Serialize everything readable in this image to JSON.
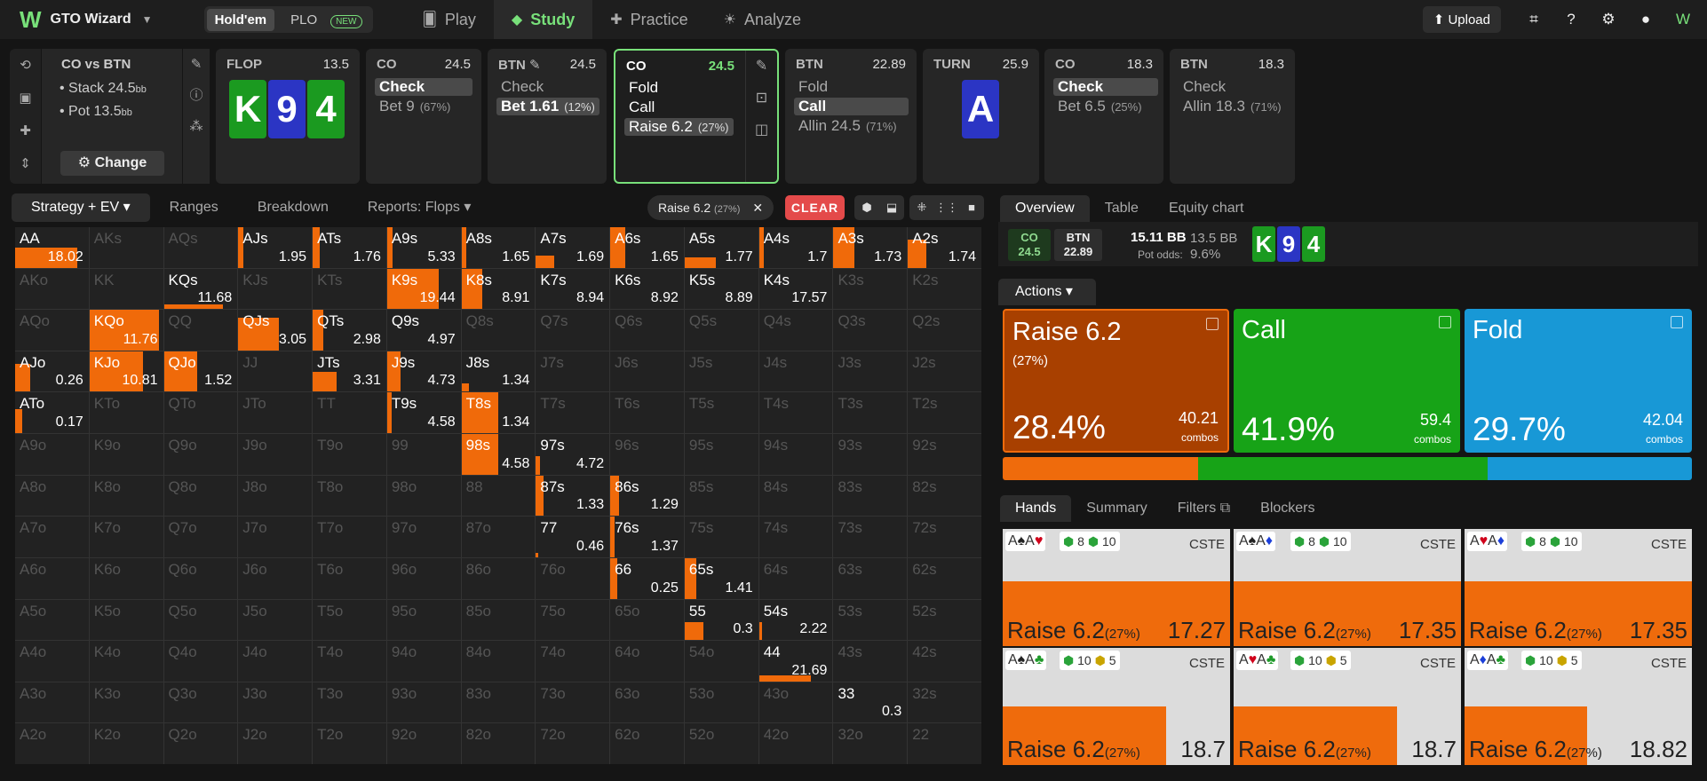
{
  "app": {
    "name": "GTO Wizard",
    "game_modes": [
      "Hold'em",
      "PLO"
    ],
    "new_badge": "NEW",
    "nav": [
      {
        "label": "Play",
        "icon": "cards-icon"
      },
      {
        "label": "Study",
        "icon": "graduation-cap-icon"
      },
      {
        "label": "Practice",
        "icon": "gamepad-icon"
      },
      {
        "label": "Analyze",
        "icon": "lightbulb-icon"
      }
    ],
    "upload_label": "Upload"
  },
  "situation": {
    "title": "CO vs BTN",
    "stack_label": "Stack 24.5",
    "stack_unit": "bb",
    "pot_label": "Pot 13.5",
    "pot_unit": "bb",
    "change_label": "Change"
  },
  "flop": {
    "label": "FLOP",
    "pot": "13.5",
    "cards": [
      "K",
      "9",
      "4"
    ]
  },
  "turn": {
    "label": "TURN",
    "pot": "25.9",
    "card": "A"
  },
  "nodes": [
    {
      "pos": "CO",
      "stack": "24.5",
      "options": [
        {
          "label": "Check",
          "pct": "",
          "sel": true
        },
        {
          "label": "Bet 9",
          "pct": "(67%)",
          "sel": false
        }
      ]
    },
    {
      "pos": "BTN",
      "stack": "24.5",
      "options": [
        {
          "label": "Check",
          "pct": "",
          "sel": false
        },
        {
          "label": "Bet 1.61",
          "pct": "(12%)",
          "sel": true
        }
      ]
    },
    {
      "pos": "CO",
      "stack": "24.5",
      "options": [
        {
          "label": "Fold",
          "pct": "",
          "sel": false
        },
        {
          "label": "Call",
          "pct": "",
          "sel": false
        },
        {
          "label": "Raise 6.2",
          "pct": "(27%)",
          "sel": true
        }
      ]
    },
    {
      "pos": "BTN",
      "stack": "22.89",
      "options": [
        {
          "label": "Fold",
          "pct": "",
          "sel": false
        },
        {
          "label": "Call",
          "pct": "",
          "sel": true
        },
        {
          "label": "Allin 24.5",
          "pct": "(71%)",
          "sel": false
        }
      ]
    },
    {
      "pos": "CO",
      "stack": "18.3",
      "options": [
        {
          "label": "Check",
          "pct": "",
          "sel": true
        },
        {
          "label": "Bet 6.5",
          "pct": "(25%)",
          "sel": false
        }
      ]
    },
    {
      "pos": "BTN",
      "stack": "18.3",
      "options": [
        {
          "label": "Check",
          "pct": "",
          "sel": false
        },
        {
          "label": "Allin 18.3",
          "pct": "(71%)",
          "sel": false
        }
      ]
    }
  ],
  "grid_toolbar": {
    "tabs": [
      "Strategy + EV",
      "Ranges",
      "Breakdown",
      "Reports: Flops"
    ],
    "filter_chip": "Raise 6.2",
    "filter_chip_pct": "(27%)",
    "clear_label": "CLEAR"
  },
  "range_grid": {
    "hands": [
      [
        "AA",
        "AKs",
        "AQs",
        "AJs",
        "ATs",
        "A9s",
        "A8s",
        "A7s",
        "A6s",
        "A5s",
        "A4s",
        "A3s",
        "A2s"
      ],
      [
        "AKo",
        "KK",
        "KQs",
        "KJs",
        "KTs",
        "K9s",
        "K8s",
        "K7s",
        "K6s",
        "K5s",
        "K4s",
        "K3s",
        "K2s"
      ],
      [
        "AQo",
        "KQo",
        "QQ",
        "QJs",
        "QTs",
        "Q9s",
        "Q8s",
        "Q7s",
        "Q6s",
        "Q5s",
        "Q4s",
        "Q3s",
        "Q2s"
      ],
      [
        "AJo",
        "KJo",
        "QJo",
        "JJ",
        "JTs",
        "J9s",
        "J8s",
        "J7s",
        "J6s",
        "J5s",
        "J4s",
        "J3s",
        "J2s"
      ],
      [
        "ATo",
        "KTo",
        "QTo",
        "JTo",
        "TT",
        "T9s",
        "T8s",
        "T7s",
        "T6s",
        "T5s",
        "T4s",
        "T3s",
        "T2s"
      ],
      [
        "A9o",
        "K9o",
        "Q9o",
        "J9o",
        "T9o",
        "99",
        "98s",
        "97s",
        "96s",
        "95s",
        "94s",
        "93s",
        "92s"
      ],
      [
        "A8o",
        "K8o",
        "Q8o",
        "J8o",
        "T8o",
        "98o",
        "88",
        "87s",
        "86s",
        "85s",
        "84s",
        "83s",
        "82s"
      ],
      [
        "A7o",
        "K7o",
        "Q7o",
        "J7o",
        "T7o",
        "97o",
        "87o",
        "77",
        "76s",
        "75s",
        "74s",
        "73s",
        "72s"
      ],
      [
        "A6o",
        "K6o",
        "Q6o",
        "J6o",
        "T6o",
        "96o",
        "86o",
        "76o",
        "66",
        "65s",
        "64s",
        "63s",
        "62s"
      ],
      [
        "A5o",
        "K5o",
        "Q5o",
        "J5o",
        "T5o",
        "95o",
        "85o",
        "75o",
        "65o",
        "55",
        "54s",
        "53s",
        "52s"
      ],
      [
        "A4o",
        "K4o",
        "Q4o",
        "J4o",
        "T4o",
        "94o",
        "84o",
        "74o",
        "64o",
        "54o",
        "44",
        "43s",
        "42s"
      ],
      [
        "A3o",
        "K3o",
        "Q3o",
        "J3o",
        "T3o",
        "93o",
        "83o",
        "73o",
        "63o",
        "53o",
        "43o",
        "33",
        "32s"
      ],
      [
        "A2o",
        "K2o",
        "Q2o",
        "J2o",
        "T2o",
        "92o",
        "82o",
        "72o",
        "62o",
        "52o",
        "42o",
        "32o",
        "22"
      ]
    ],
    "ev": {
      "AA": "18.02",
      "AJs": "1.95",
      "ATs": "1.76",
      "A9s": "5.33",
      "A8s": "1.65",
      "A7s": "1.69",
      "A6s": "1.65",
      "A5s": "1.77",
      "A4s": "1.7",
      "A3s": "1.73",
      "A2s": "1.74",
      "KQs": "11.68",
      "K9s": "19.44",
      "K8s": "8.91",
      "K7s": "8.94",
      "K6s": "8.92",
      "K5s": "8.89",
      "K4s": "17.57",
      "KQo": "11.76",
      "QJs": "3.05",
      "QTs": "2.98",
      "Q9s": "4.97",
      "AJo": "0.26",
      "KJo": "10.81",
      "QJo": "1.52",
      "JTs": "3.31",
      "J9s": "4.73",
      "J8s": "1.34",
      "ATo": "0.17",
      "T9s": "4.58",
      "T8s": "1.34",
      "98s": "4.58",
      "97s": "4.72",
      "87s": "1.33",
      "86s": "1.29",
      "77": "0.46",
      "76s": "1.37",
      "66": "0.25",
      "65s": "1.41",
      "55": "0.3",
      "54s": "2.22",
      "44": "21.69",
      "33": "0.3"
    },
    "raise_freq": {
      "AA": 0.85,
      "AJs": 0.07,
      "ATs": 0.1,
      "A9s": 0.07,
      "A8s": 0.06,
      "A7s": 0.25,
      "A6s": 0.2,
      "A5s": 0.42,
      "A4s": 0.07,
      "A3s": 0.28,
      "A2s": 0.25,
      "KQs": 0.8,
      "K9s": 0.7,
      "K8s": 0.28,
      "KQo": 0.95,
      "QJs": 0.55,
      "QTs": 0.14,
      "AJo": 0.2,
      "KJo": 0.73,
      "QJo": 0.45,
      "JTs": 0.32,
      "J9s": 0.18,
      "J8s": 0.1,
      "ATo": 0.1,
      "T9s": 0.06,
      "T8s": 0.5,
      "98s": 0.5,
      "97s": 0.05,
      "87s": 0.1,
      "86s": 0.12,
      "77": 0.03,
      "76s": 0.06,
      "66": 0.1,
      "65s": 0.16,
      "55": 0.25,
      "54s": 0.04,
      "44": 0.7
    },
    "raise_height": {
      "AA": 0.5,
      "AJs": 1,
      "ATs": 1,
      "A9s": 1,
      "A8s": 1,
      "A7s": 0.3,
      "A6s": 1,
      "A5s": 0.25,
      "A4s": 1,
      "A3s": 1,
      "A2s": 0.7,
      "KQs": 0.12,
      "K9s": 1,
      "K8s": 1,
      "KQo": 1,
      "QJs": 0.8,
      "QTs": 1,
      "AJo": 0.7,
      "KJo": 1,
      "QJo": 1,
      "JTs": 0.5,
      "J9s": 1,
      "J8s": 0.2,
      "ATo": 0.6,
      "T9s": 1,
      "T8s": 1,
      "98s": 1,
      "97s": 0.45,
      "87s": 1,
      "86s": 1,
      "77": 0.1,
      "76s": 1,
      "66": 1,
      "65s": 1,
      "55": 0.45,
      "54s": 0.45,
      "44": 0.14
    },
    "bright": [
      "AA",
      "AJs",
      "ATs",
      "A9s",
      "A8s",
      "A7s",
      "A6s",
      "A5s",
      "A4s",
      "A3s",
      "A2s",
      "KQs",
      "K9s",
      "K8s",
      "K7s",
      "K6s",
      "K5s",
      "K4s",
      "KQo",
      "QJs",
      "QTs",
      "Q9s",
      "AJo",
      "KJo",
      "QJo",
      "JTs",
      "J9s",
      "J8s",
      "ATo",
      "T9s",
      "T8s",
      "98s",
      "97s",
      "87s",
      "86s",
      "77",
      "76s",
      "66",
      "65s",
      "55",
      "54s",
      "44",
      "33"
    ]
  },
  "right_panel": {
    "tabs": [
      "Overview",
      "Table",
      "Equity chart"
    ],
    "info": {
      "p1": "CO",
      "p1_stack": "24.5",
      "p2": "BTN",
      "p2_stack": "22.89",
      "pot_bb": "15.11 BB",
      "stack_bb": "13.5 BB",
      "pot_odds_label": "Pot odds:",
      "pot_odds": "9.6%",
      "board": [
        "K",
        "9",
        "4"
      ]
    },
    "actions_label": "Actions",
    "actions": [
      {
        "name": "Raise 6.2",
        "sub": "(27%)",
        "pct": "28.4%",
        "combos": "40.21",
        "combos_label": "combos",
        "color": "#a84000"
      },
      {
        "name": "Call",
        "sub": "",
        "pct": "41.9%",
        "combos": "59.4",
        "combos_label": "combos",
        "color": "#17a317"
      },
      {
        "name": "Fold",
        "sub": "",
        "pct": "29.7%",
        "combos": "42.04",
        "combos_label": "combos",
        "color": "#1898d6"
      }
    ],
    "freq_bar": [
      {
        "value": 28.4,
        "color": "#ef6b0c"
      },
      {
        "value": 41.9,
        "color": "#17a317"
      },
      {
        "value": 29.7,
        "color": "#1898d6"
      }
    ],
    "hand_tabs": [
      "Hands",
      "Summary",
      "Filters",
      "Blockers"
    ]
  },
  "hands": [
    {
      "c1": "A",
      "s1": "♠",
      "c2": "A",
      "s2": "♥",
      "b1": "8",
      "b2": "10",
      "tag": "CSTE",
      "action": "Raise 6.2",
      "pct": "(27%)",
      "ev": "17.27",
      "fill": 0.55
    },
    {
      "c1": "A",
      "s1": "♠",
      "c2": "A",
      "s2": "♦",
      "b1": "8",
      "b2": "10",
      "tag": "CSTE",
      "action": "Raise 6.2",
      "pct": "(27%)",
      "ev": "17.35",
      "fill": 0.55
    },
    {
      "c1": "A",
      "s1": "♥",
      "c2": "A",
      "s2": "♦",
      "b1": "8",
      "b2": "10",
      "tag": "CSTE",
      "action": "Raise 6.2",
      "pct": "(27%)",
      "ev": "17.35",
      "fill": 0.55
    },
    {
      "c1": "A",
      "s1": "♠",
      "c2": "A",
      "s2": "♣",
      "b1": "10",
      "b2": "5",
      "tag": "CSTE",
      "action": "Raise 6.2",
      "pct": "(27%)",
      "ev": "18.7",
      "fill": 0.5
    },
    {
      "c1": "A",
      "s1": "♥",
      "c2": "A",
      "s2": "♣",
      "b1": "10",
      "b2": "5",
      "tag": "CSTE",
      "action": "Raise 6.2",
      "pct": "(27%)",
      "ev": "18.7",
      "fill": 0.5
    },
    {
      "c1": "A",
      "s1": "♦",
      "c2": "A",
      "s2": "♣",
      "b1": "10",
      "b2": "5",
      "tag": "CSTE",
      "action": "Raise 6.2",
      "pct": "(27%)",
      "ev": "18.82",
      "fill": 0.5
    }
  ]
}
